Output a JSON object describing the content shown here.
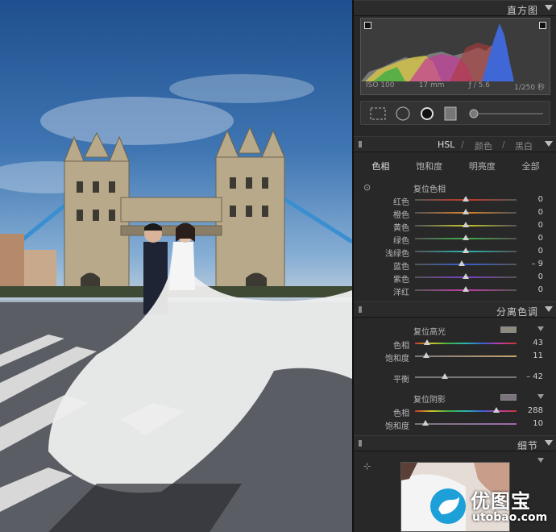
{
  "panel": {
    "histogram": {
      "title": "直方图",
      "iso": "ISO 100",
      "focal": "17 mm",
      "aperture": "ƒ / 5.6",
      "shutter": "1/250 秒"
    },
    "hsl": {
      "header_hsl": "HSL",
      "header_sep1": "/",
      "header_color": "颜色",
      "header_sep2": "/",
      "header_bw": "黑白",
      "tabs": [
        "色相",
        "饱和度",
        "明亮度",
        "全部"
      ],
      "reset_label": "复位色相",
      "sliders": [
        {
          "label": "红色",
          "value": "0",
          "pos": 0.5,
          "color": "#c0392b"
        },
        {
          "label": "橙色",
          "value": "0",
          "pos": 0.5,
          "color": "#d9822b"
        },
        {
          "label": "黄色",
          "value": "0",
          "pos": 0.5,
          "color": "#c9c52b"
        },
        {
          "label": "绿色",
          "value": "0",
          "pos": 0.5,
          "color": "#3fae45"
        },
        {
          "label": "浅绿色",
          "value": "0",
          "pos": 0.5,
          "color": "#2bb5b0"
        },
        {
          "label": "蓝色",
          "value": "– 9",
          "pos": 0.46,
          "color": "#3a5fd0"
        },
        {
          "label": "紫色",
          "value": "0",
          "pos": 0.5,
          "color": "#7b3fc8"
        },
        {
          "label": "洋红",
          "value": "0",
          "pos": 0.5,
          "color": "#c43ba8"
        }
      ]
    },
    "split_toning": {
      "title": "分离色调",
      "highlight_reset": "复位高光",
      "highlight_hue_label": "色相",
      "highlight_hue_value": "43",
      "highlight_hue_pos": 0.12,
      "highlight_sat_label": "饱和度",
      "highlight_sat_value": "11",
      "highlight_sat_pos": 0.11,
      "balance_label": "平衡",
      "balance_value": "– 42",
      "balance_pos": 0.29,
      "shadow_reset": "复位阴影",
      "shadow_hue_label": "色相",
      "shadow_hue_value": "288",
      "shadow_hue_pos": 0.8,
      "shadow_sat_label": "饱和度",
      "shadow_sat_value": "10",
      "shadow_sat_pos": 0.1,
      "highlight_swatch": "#8d8a80",
      "shadow_swatch": "#7a737e"
    },
    "detail": {
      "title": "细节"
    }
  },
  "watermark": {
    "cn": "优图宝",
    "en": "utobao.com"
  }
}
